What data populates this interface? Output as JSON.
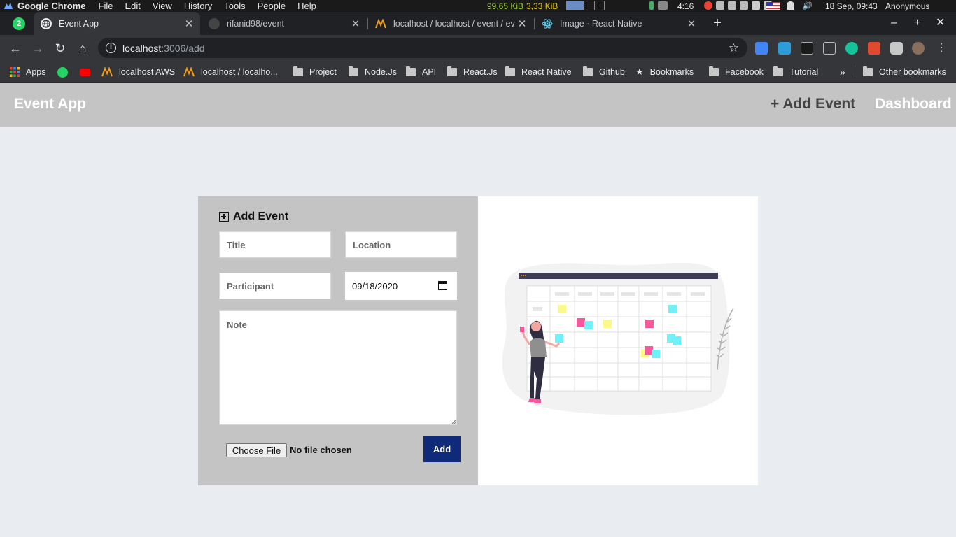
{
  "os_bar": {
    "app_name": "Google Chrome",
    "menus": [
      "File",
      "Edit",
      "View",
      "History",
      "Tools",
      "People",
      "Help"
    ],
    "net_down": "99,65 KiB",
    "net_up": "3,33 KiB",
    "tray_time": "4:16",
    "clock": "18 Sep, 09:43",
    "user": "Anonymous"
  },
  "tabs": [
    {
      "label": "Event App",
      "active": true,
      "icon": "globe-icon"
    },
    {
      "label": "rifanid98/event",
      "active": false,
      "icon": "github-icon"
    },
    {
      "label": "localhost / localhost / event / ev",
      "active": false,
      "icon": "phpmyadmin-icon"
    },
    {
      "label": "Image · React Native",
      "active": false,
      "icon": "react-icon"
    }
  ],
  "whatsapp_badge": "2",
  "address": {
    "host": "localhost",
    "path": ":3006/add"
  },
  "bookmarks": [
    {
      "label": "Apps",
      "icon": "apps-grid-icon"
    },
    {
      "label": "",
      "icon": "whatsapp-icon"
    },
    {
      "label": "",
      "icon": "youtube-icon"
    },
    {
      "label": "localhost AWS",
      "icon": "phpmyadmin-icon"
    },
    {
      "label": "localhost / localho...",
      "icon": "phpmyadmin-icon"
    },
    {
      "label": "Project",
      "icon": "folder-icon"
    },
    {
      "label": "Node.Js",
      "icon": "folder-icon"
    },
    {
      "label": "API",
      "icon": "folder-icon"
    },
    {
      "label": "React.Js",
      "icon": "folder-icon"
    },
    {
      "label": "React Native",
      "icon": "folder-icon"
    },
    {
      "label": "Github",
      "icon": "folder-icon"
    },
    {
      "label": "Bookmarks",
      "icon": "star-icon"
    },
    {
      "label": "Facebook",
      "icon": "folder-icon"
    },
    {
      "label": "Tutorial",
      "icon": "folder-icon"
    }
  ],
  "overflow_label": "»",
  "other_bookmarks": "Other bookmarks",
  "app": {
    "brand": "Event App",
    "nav_add": "+ Add Event",
    "nav_dashboard": "Dashboard"
  },
  "form": {
    "heading": "Add Event",
    "title_placeholder": "Title",
    "location_placeholder": "Location",
    "participant_placeholder": "Participant",
    "date_value": "09/18/2020",
    "note_placeholder": "Note",
    "file_button": "Choose File",
    "file_status": "No file chosen",
    "submit": "Add"
  },
  "colors": {
    "navbar_bg": "#c4c4c4",
    "page_bg": "#e9ecf1",
    "submit_bg": "#0e2a78",
    "sticky_pink": "#f7579c",
    "sticky_yellow": "#fbf98a",
    "sticky_cyan": "#6ff1f7"
  }
}
